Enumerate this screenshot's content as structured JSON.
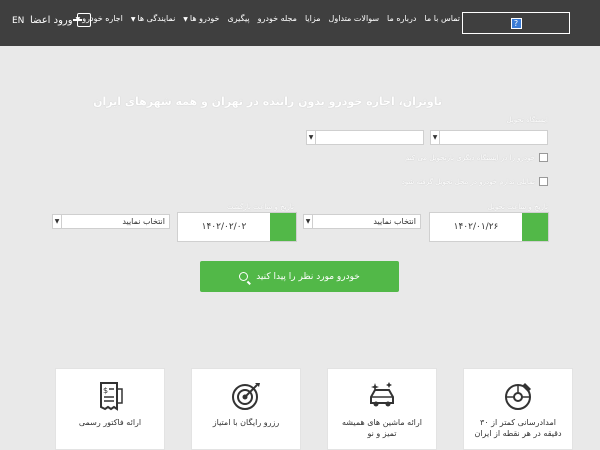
{
  "header": {
    "lang": "EN",
    "login_label": "ورود اعضا",
    "nav": [
      {
        "label": "اجاره خودرو",
        "caret": true
      },
      {
        "label": "نمایندگی ها",
        "caret": true
      },
      {
        "label": "خودرو ها",
        "caret": true
      },
      {
        "label": "پیگیری",
        "caret": false
      },
      {
        "label": "مجله خودرو",
        "caret": false
      },
      {
        "label": "مزایا",
        "caret": false
      },
      {
        "label": "سوالات متداول",
        "caret": false
      },
      {
        "label": "درباره ما",
        "caret": false
      },
      {
        "label": "تماس با ما",
        "caret": false
      }
    ],
    "logo_glyph": "?"
  },
  "hero": {
    "title": "تاوتران، اجاره خودرو بدون راننده در تهران و همه شهرهای ایران",
    "pickup_station_label": "ایستگاه تحویل",
    "check_same_station": "خودرو را در ایستگاه دیگری بازتحویل می کنم",
    "check_other": "تمایلی ندارم خودرو در محل تحویل گرفته شود",
    "pickup_date_label": "تاریخ و ساعت تحویل",
    "return_date_label": "تاریخ و ساعت بازگشت",
    "pickup_date": "۱۴۰۲/۰۱/۲۶",
    "return_date": "۱۴۰۲/۰۲/۰۲",
    "select_placeholder": "انتخاب نمایید",
    "search_button": "خودرو مورد نظر را پیدا کنید"
  },
  "cards": [
    {
      "icon": "wrench-wheel-icon",
      "text": "امدادرسانی کمتر از ۳۰ دقیقه در هر نقطه از ایران"
    },
    {
      "icon": "car-sparkle-icon",
      "text": "ارائه ماشین های همیشه تمیز و نو"
    },
    {
      "icon": "target-icon",
      "text": "رزرو رایگان با امتیاز"
    },
    {
      "icon": "invoice-icon",
      "text": "ارائه فاکتور رسمی"
    }
  ],
  "colors": {
    "header_bg": "#3f3f3f",
    "accent_green": "#52b848",
    "page_bg": "#e9e9e9"
  }
}
